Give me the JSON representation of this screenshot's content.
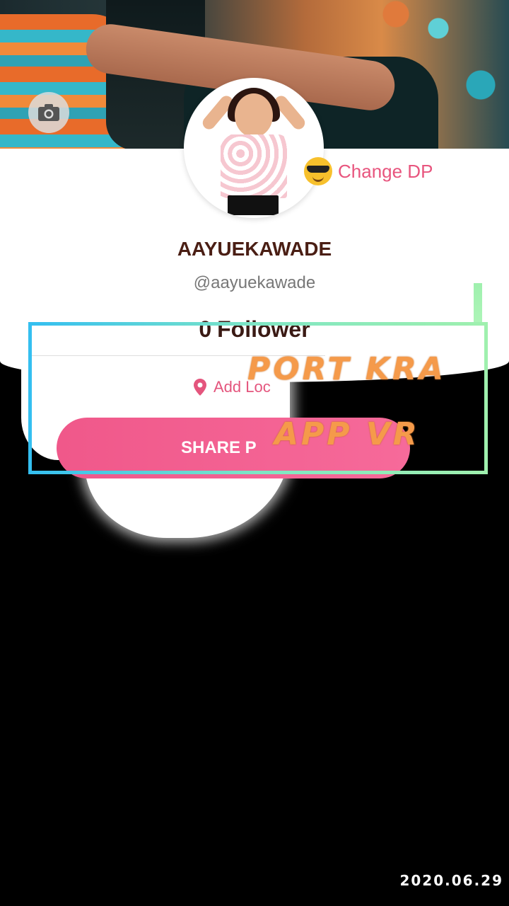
{
  "profile": {
    "username": "AAYUEKAWADE",
    "handle": "@aayuekawade",
    "follower_count": "0",
    "follower_label": "Follower",
    "change_dp_label": "Change DP",
    "location_label": "Add Loc",
    "share_label": "SHARE P"
  },
  "overlay": {
    "line1": "PORT KRA",
    "line2": "APP VR"
  },
  "footer": {
    "date": "2020.06.29"
  },
  "colors": {
    "accent": "#e8557e",
    "button": "#f0588a",
    "overlay_text": "#f59a4a"
  },
  "icons": {
    "camera": "camera-icon",
    "emoji": "sunglasses-emoji-icon",
    "location": "location-pin-icon"
  }
}
